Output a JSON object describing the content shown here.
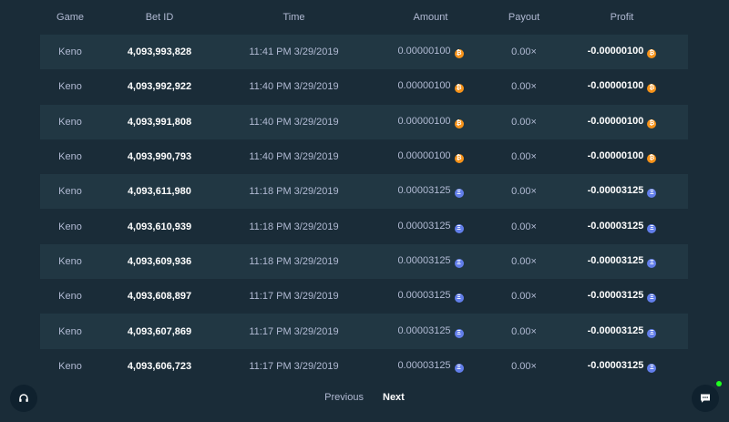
{
  "table": {
    "headers": {
      "game": "Game",
      "bet_id": "Bet ID",
      "time": "Time",
      "amount": "Amount",
      "payout": "Payout",
      "profit": "Profit"
    },
    "rows": [
      {
        "game": "Keno",
        "bet_id": "4,093,993,828",
        "time": "11:41 PM 3/29/2019",
        "amount": "0.00000100",
        "payout": "0.00×",
        "profit": "-0.00000100",
        "currency": "btc"
      },
      {
        "game": "Keno",
        "bet_id": "4,093,992,922",
        "time": "11:40 PM 3/29/2019",
        "amount": "0.00000100",
        "payout": "0.00×",
        "profit": "-0.00000100",
        "currency": "btc"
      },
      {
        "game": "Keno",
        "bet_id": "4,093,991,808",
        "time": "11:40 PM 3/29/2019",
        "amount": "0.00000100",
        "payout": "0.00×",
        "profit": "-0.00000100",
        "currency": "btc"
      },
      {
        "game": "Keno",
        "bet_id": "4,093,990,793",
        "time": "11:40 PM 3/29/2019",
        "amount": "0.00000100",
        "payout": "0.00×",
        "profit": "-0.00000100",
        "currency": "btc"
      },
      {
        "game": "Keno",
        "bet_id": "4,093,611,980",
        "time": "11:18 PM 3/29/2019",
        "amount": "0.00003125",
        "payout": "0.00×",
        "profit": "-0.00003125",
        "currency": "eth"
      },
      {
        "game": "Keno",
        "bet_id": "4,093,610,939",
        "time": "11:18 PM 3/29/2019",
        "amount": "0.00003125",
        "payout": "0.00×",
        "profit": "-0.00003125",
        "currency": "eth"
      },
      {
        "game": "Keno",
        "bet_id": "4,093,609,936",
        "time": "11:18 PM 3/29/2019",
        "amount": "0.00003125",
        "payout": "0.00×",
        "profit": "-0.00003125",
        "currency": "eth"
      },
      {
        "game": "Keno",
        "bet_id": "4,093,608,897",
        "time": "11:17 PM 3/29/2019",
        "amount": "0.00003125",
        "payout": "0.00×",
        "profit": "-0.00003125",
        "currency": "eth"
      },
      {
        "game": "Keno",
        "bet_id": "4,093,607,869",
        "time": "11:17 PM 3/29/2019",
        "amount": "0.00003125",
        "payout": "0.00×",
        "profit": "-0.00003125",
        "currency": "eth"
      },
      {
        "game": "Keno",
        "bet_id": "4,093,606,723",
        "time": "11:17 PM 3/29/2019",
        "amount": "0.00003125",
        "payout": "0.00×",
        "profit": "-0.00003125",
        "currency": "eth"
      }
    ]
  },
  "pagination": {
    "previous_label": "Previous",
    "next_label": "Next"
  },
  "icons": {
    "btc": "bitcoin-icon",
    "eth": "ethereum-icon",
    "support": "headset-icon",
    "chat": "chat-icon"
  },
  "colors": {
    "background": "#1a2c38",
    "row_alt": "#213743",
    "btc": "#f7931a",
    "eth": "#627eea",
    "online": "#1fff20"
  }
}
